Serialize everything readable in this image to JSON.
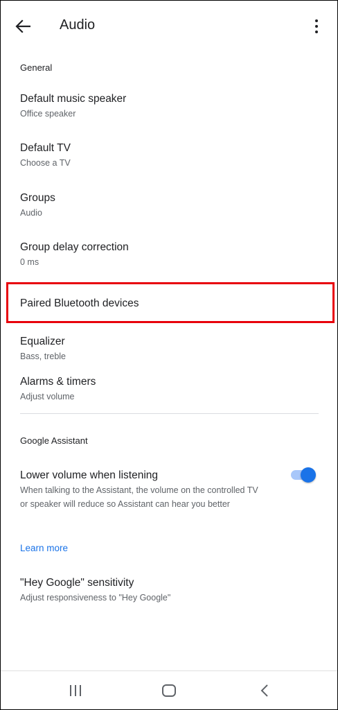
{
  "header": {
    "title": "Audio",
    "back_icon": "arrow-back-icon",
    "more_icon": "more-vert-icon"
  },
  "general": {
    "section_title": "General",
    "items": [
      {
        "title": "Default music speaker",
        "subtitle": "Office speaker"
      },
      {
        "title": "Default TV",
        "subtitle": "Choose a TV"
      },
      {
        "title": "Groups",
        "subtitle": "Audio"
      },
      {
        "title": "Group delay correction",
        "subtitle": "0 ms"
      },
      {
        "title": "Paired Bluetooth devices",
        "subtitle": ""
      },
      {
        "title": "Equalizer",
        "subtitle": "Bass, treble"
      },
      {
        "title": "Alarms & timers",
        "subtitle": "Adjust volume"
      }
    ]
  },
  "assistant": {
    "section_title": "Google Assistant",
    "lower_volume": {
      "title": "Lower volume when listening",
      "description": "When talking to the Assistant, the volume on the controlled TV or speaker will reduce so Assistant can hear you better",
      "enabled": true
    },
    "learn_more": "Learn more",
    "sensitivity": {
      "title": "\"Hey Google\" sensitivity",
      "subtitle": "Adjust responsiveness to \"Hey Google\""
    }
  },
  "highlight_color": "#e8000b",
  "accent_color": "#1a73e8",
  "navbar": {
    "recents_icon": "recents-icon",
    "home_icon": "home-icon",
    "back_icon": "nav-back-icon"
  }
}
